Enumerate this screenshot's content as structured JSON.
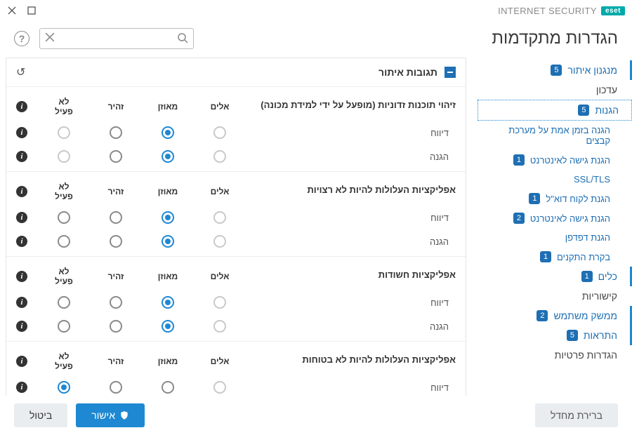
{
  "brand": {
    "badge": "eset",
    "product": "INTERNET SECURITY"
  },
  "title": "הגדרות מתקדמות",
  "search": {
    "placeholder": ""
  },
  "help": "?",
  "sidebar": [
    {
      "label": "מנגנון איתור",
      "badge": "5",
      "kind": "top"
    },
    {
      "label": "עדכון",
      "kind": "plain"
    },
    {
      "label": "הגנות",
      "badge": "5",
      "kind": "sel"
    },
    {
      "label": "הגנה בזמן אמת על מערכת קבצים",
      "kind": "sub"
    },
    {
      "label": "הגנת גישה לאינטרנט",
      "badge": "1",
      "kind": "sub"
    },
    {
      "label": "SSL/TLS",
      "kind": "sub2"
    },
    {
      "label": "הגנת לקוח דוא\"ל",
      "badge": "1",
      "kind": "sub"
    },
    {
      "label": "הגנת גישה לאינטרנט",
      "badge": "2",
      "kind": "sub"
    },
    {
      "label": "הגנת דפדפן",
      "kind": "sub"
    },
    {
      "label": "בקרת התקנים",
      "badge": "1",
      "kind": "sub"
    },
    {
      "label": "כלים",
      "badge": "1",
      "kind": "top"
    },
    {
      "label": "קישוריות",
      "kind": "plain"
    },
    {
      "label": "ממשק משתמש",
      "badge": "2",
      "kind": "top"
    },
    {
      "label": "התראות",
      "badge": "5",
      "kind": "top"
    },
    {
      "label": "הגדרות פרטיות",
      "kind": "plain"
    }
  ],
  "panel": {
    "title": "תגובות איתור"
  },
  "levels": {
    "aggressive": "אלים",
    "balanced": "מאוזן",
    "cautious": "זהיר",
    "off": "לא פעיל"
  },
  "row_labels": {
    "reporting": "דיווח",
    "protection": "הגנה"
  },
  "sections": [
    {
      "title": "זיהוי תוכנות זדוניות (מופעל על ידי למידת מכונה)",
      "rows": [
        {
          "label_key": "reporting",
          "value": "balanced",
          "off_enabled": false
        },
        {
          "label_key": "protection",
          "value": "balanced",
          "off_enabled": false
        }
      ]
    },
    {
      "title": "אפליקציות העלולות להיות לא רצויות",
      "rows": [
        {
          "label_key": "reporting",
          "value": "balanced",
          "off_enabled": true
        },
        {
          "label_key": "protection",
          "value": "balanced",
          "off_enabled": true
        }
      ]
    },
    {
      "title": "אפליקציות חשודות",
      "rows": [
        {
          "label_key": "reporting",
          "value": "balanced",
          "off_enabled": true
        },
        {
          "label_key": "protection",
          "value": "balanced",
          "off_enabled": true
        }
      ]
    },
    {
      "title": "אפליקציות העלולות להיות לא בטוחות",
      "rows": [
        {
          "label_key": "reporting",
          "value": "off",
          "off_enabled": true
        }
      ]
    }
  ],
  "footer": {
    "default": "ברירת מחדל",
    "ok": "אישור",
    "cancel": "ביטול"
  }
}
